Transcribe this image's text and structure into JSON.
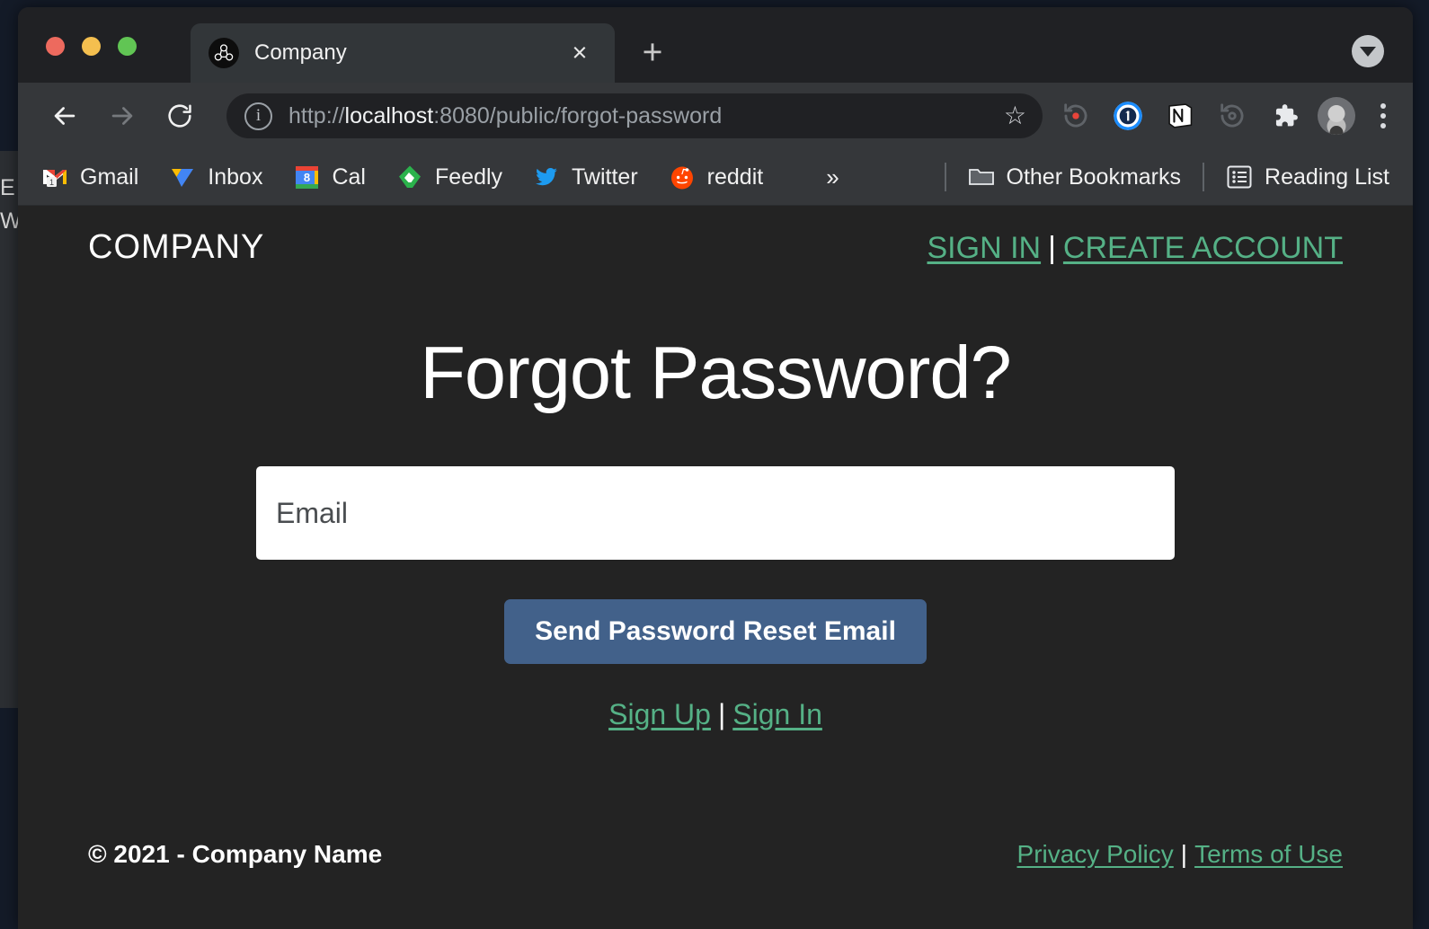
{
  "desktop": {
    "bg_fragments": [
      "E",
      "W"
    ]
  },
  "browser": {
    "window_controls": [
      {
        "name": "close",
        "color": "#ed6a5e"
      },
      {
        "name": "minimize",
        "color": "#f4bf4f"
      },
      {
        "name": "maximize",
        "color": "#61c554"
      }
    ],
    "tab": {
      "title": "Company",
      "favicon": "molecule-icon",
      "close_label": "×"
    },
    "new_tab_label": "+",
    "tab_search_icon": "chevron-down-circle-icon",
    "nav": {
      "back_icon": "back-arrow-icon",
      "forward_icon": "forward-arrow-icon",
      "reload_icon": "reload-icon"
    },
    "omnibox": {
      "info_icon": "site-info-icon",
      "url_prefix": "http://",
      "url_host": "localhost",
      "url_suffix": ":8080/public/forgot-password",
      "url_full": "http://localhost:8080/public/forgot-password",
      "bookmark_icon": "star-icon"
    },
    "extensions": [
      {
        "name": "recorder-record-icon",
        "label": ""
      },
      {
        "name": "onepassword-icon",
        "label": "1"
      },
      {
        "name": "notion-icon",
        "label": "N"
      },
      {
        "name": "recorder-icon",
        "label": ""
      },
      {
        "name": "puzzle-extensions-icon",
        "label": ""
      }
    ],
    "profile_icon": "avatar",
    "menu_icon": "kebab-menu-icon",
    "bookmarks": [
      {
        "label": "Gmail",
        "icon": "gmail-icon",
        "badge": "1"
      },
      {
        "label": "Inbox",
        "icon": "inbox-icon",
        "badge": ""
      },
      {
        "label": "Cal",
        "icon": "google-calendar-icon",
        "badge": "8"
      },
      {
        "label": "Feedly",
        "icon": "feedly-icon",
        "badge": ""
      },
      {
        "label": "Twitter",
        "icon": "twitter-icon",
        "badge": ""
      },
      {
        "label": "reddit",
        "icon": "reddit-icon",
        "badge": ""
      }
    ],
    "bookmarks_overflow": "»",
    "other_bookmarks": {
      "label": "Other Bookmarks",
      "icon": "folder-icon"
    },
    "reading_list": {
      "label": "Reading List",
      "icon": "reading-list-icon"
    }
  },
  "page": {
    "brand": "COMPANY",
    "top_nav": {
      "sign_in": "SIGN IN",
      "separator": "|",
      "create_account": "CREATE ACCOUNT"
    },
    "headline": "Forgot Password?",
    "email_field": {
      "placeholder": "Email",
      "value": ""
    },
    "submit_label": "Send Password Reset Email",
    "alt_links": {
      "sign_up": "Sign Up",
      "separator": "|",
      "sign_in": "Sign In"
    },
    "footer": {
      "copyright": "© 2021 - Company Name",
      "privacy": "Privacy Policy",
      "separator": "|",
      "terms": "Terms of Use"
    },
    "colors": {
      "background": "#232323",
      "link_green": "#55b186",
      "button_blue": "#42618a",
      "text_white": "#ffffff"
    }
  }
}
